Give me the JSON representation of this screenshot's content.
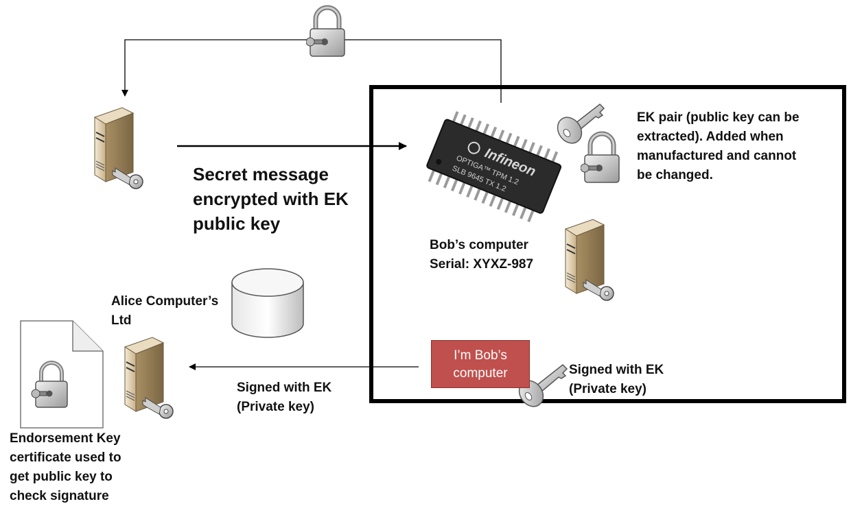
{
  "title": "",
  "labels": {
    "ek_pair": [
      "EK pair (public key can be",
      "extracted). Added when",
      "manufactured and cannot",
      "be changed."
    ],
    "secret_message": [
      "Secret message",
      "encrypted with EK",
      "public key"
    ],
    "bobs_computer": [
      "Bob’s computer",
      "Serial: XYXZ-987"
    ],
    "alice_ltd": [
      "Alice Computer’s",
      "Ltd"
    ],
    "signed_with_ek_left": [
      "Signed with EK",
      "(Private key)"
    ],
    "signed_with_ek_right": [
      "Signed with EK",
      "(Private key)"
    ],
    "endorsement_cert": [
      "Endorsement Key",
      "certificate used to",
      "get public key to",
      "check signature"
    ],
    "im_bobs_computer": [
      "I’m Bob’s",
      "computer"
    ]
  },
  "chip": {
    "brand": "Infineon",
    "line1": "OPTIGA™ TPM 1.2",
    "line2": "SLB 9645 TX 1.2"
  },
  "icons": {
    "lock_top": "padlock-icon",
    "alice_server": "server-icon",
    "bob_server": "server-icon",
    "database": "database-icon",
    "certificate": "document-icon",
    "ek_key": "key-icon",
    "ek_lock": "padlock-icon",
    "sign_key": "key-icon"
  },
  "colors": {
    "signed_box": "#c0504d",
    "frame": "#000000"
  }
}
